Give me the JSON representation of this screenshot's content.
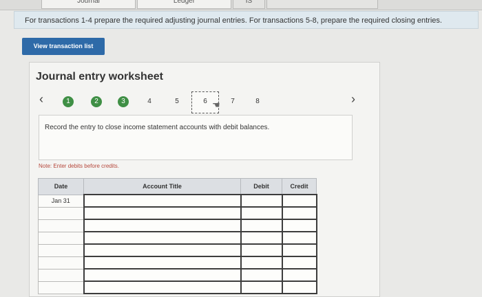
{
  "tabs": [
    {
      "label": "Journal"
    },
    {
      "label": "Ledger"
    },
    {
      "label": "IS"
    },
    {
      "label": ""
    }
  ],
  "instruction": "For transactions 1-4 prepare the required adjusting journal entries. For transactions 5-8, prepare the required closing entries.",
  "view_button": "View transaction list",
  "worksheet": {
    "title": "Journal entry worksheet",
    "prev": "‹",
    "next": "›",
    "steps": [
      {
        "label": "1",
        "state": "done"
      },
      {
        "label": "2",
        "state": "done"
      },
      {
        "label": "3",
        "state": "done"
      },
      {
        "label": "4",
        "state": "todo"
      },
      {
        "label": "5",
        "state": "todo"
      },
      {
        "label": "6",
        "state": "active"
      },
      {
        "label": "7",
        "state": "todo"
      },
      {
        "label": "8",
        "state": "todo"
      }
    ],
    "prompt": "Record the entry to close income statement accounts with debit balances.",
    "note": "Note: Enter debits before credits."
  },
  "table": {
    "headers": {
      "date": "Date",
      "account": "Account Title",
      "debit": "Debit",
      "credit": "Credit"
    },
    "rows": [
      {
        "date": "Jan 31",
        "account": "",
        "debit": "",
        "credit": ""
      },
      {
        "date": "",
        "account": "",
        "debit": "",
        "credit": ""
      },
      {
        "date": "",
        "account": "",
        "debit": "",
        "credit": ""
      },
      {
        "date": "",
        "account": "",
        "debit": "",
        "credit": ""
      },
      {
        "date": "",
        "account": "",
        "debit": "",
        "credit": ""
      },
      {
        "date": "",
        "account": "",
        "debit": "",
        "credit": ""
      },
      {
        "date": "",
        "account": "",
        "debit": "",
        "credit": ""
      },
      {
        "date": "",
        "account": "",
        "debit": "",
        "credit": ""
      }
    ]
  },
  "colors": {
    "done_step": "#3f8f45",
    "button": "#2e6aa8",
    "note": "#b5463a"
  }
}
